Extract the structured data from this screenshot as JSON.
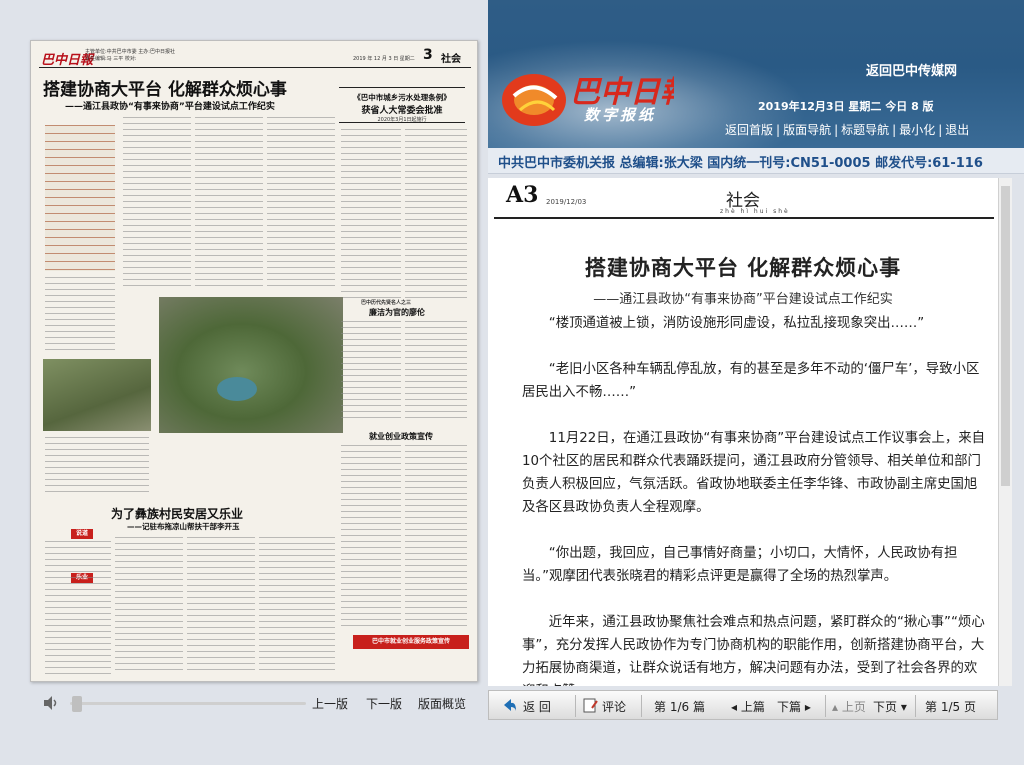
{
  "header": {
    "return_link": "返回巴中传媒网",
    "logo_text": "巴中日報",
    "logo_sub": "数字报纸",
    "date_line": "2019年12月3日 星期二 今日 8 版",
    "nav": [
      "返回首版",
      "版面导航",
      "标题导航",
      "最小化",
      "退出"
    ],
    "nav_sep": "|"
  },
  "info_strip": "中共巴中市委机关报 总编辑:张大梁 国内统一刊号:CN51-0005 邮发代号:61-116",
  "page": {
    "code": "A3",
    "date": "2019/12/03",
    "section": "社会",
    "pinyin": "zhè   hì   hui  shè"
  },
  "article": {
    "title": "搭建协商大平台  化解群众烦心事",
    "subtitle": "——通江县政协“有事来协商”平台建设试点工作纪实",
    "paragraphs": [
      "“楼顶通道被上锁，消防设施形同虚设，私拉乱接现象突出……”",
      "“老旧小区各种车辆乱停乱放，有的甚至是多年不动的‘僵尸车’，导致小区居民出入不畅……”",
      "11月22日，在通江县政协“有事来协商”平台建设试点工作议事会上，来自10个社区的居民和群众代表踊跃提问，通江县政府分管领导、相关单位和部门负责人积极回应，气氛活跃。省政协地联委主任李华锋、市政协副主席史国旭及各区县政协负责人全程观摩。",
      "“你出题，我回应，自己事情好商量；小切口，大情怀，人民政协有担当。”观摩团代表张晓君的精彩点评更是赢得了全场的热烈掌声。",
      "近年来，通江县政协聚焦社会难点和热点问题，紧盯群众的“揪心事”“烦心事”，充分发挥人民政协作为专门协商机构的职能作用，创新搭建协商平台，大力拓展协商渠道，让群众说话有地方，解决问题有办法，受到了社会各界的欢迎和点赞。"
    ]
  },
  "toolbar": {
    "back": "返 回",
    "comment": "评论",
    "article_page": "第 1/6 篇",
    "prev_article": "上篇",
    "next_article": "下篇",
    "prev_page": "上页",
    "next_page": "下页",
    "page_of": "第 1/5 页"
  },
  "left_toolbar": {
    "prev_edition": "上一版",
    "next_edition": "下一版",
    "preview": "版面概览"
  },
  "newspaper": {
    "masthead": "巴中日報",
    "meta_line1": "主管单位:中共巴中市委 主办:巴中日报社",
    "meta_line2": "责任编辑:马  三平  校对:",
    "date": "2019 年 12 月 3 日  星期二",
    "page_num": "3",
    "section": "社会",
    "lead_title": "搭建协商大平台  化解群众烦心事",
    "lead_subtitle": "——通江县政协“有事来协商”平台建设试点工作纪实",
    "box_title": "《巴中市城乡污水处理条例》",
    "box_title2": "获省人大常委会批准",
    "box_note": "2020年3月1日起施行",
    "story2_title": "廉洁为官的廖伦",
    "story2_kicker": "巴中历代先贤名人之三",
    "story3_title": "就业创业政策宣传",
    "story4_title": "为了彝族村民安居又乐业",
    "story4_sub": "——记驻布拖凉山帮扶干部李开玉",
    "red_tag1": "说道",
    "red_tag2": "乐业",
    "footer_red": "巴中市就业创业服务政策宣传"
  }
}
